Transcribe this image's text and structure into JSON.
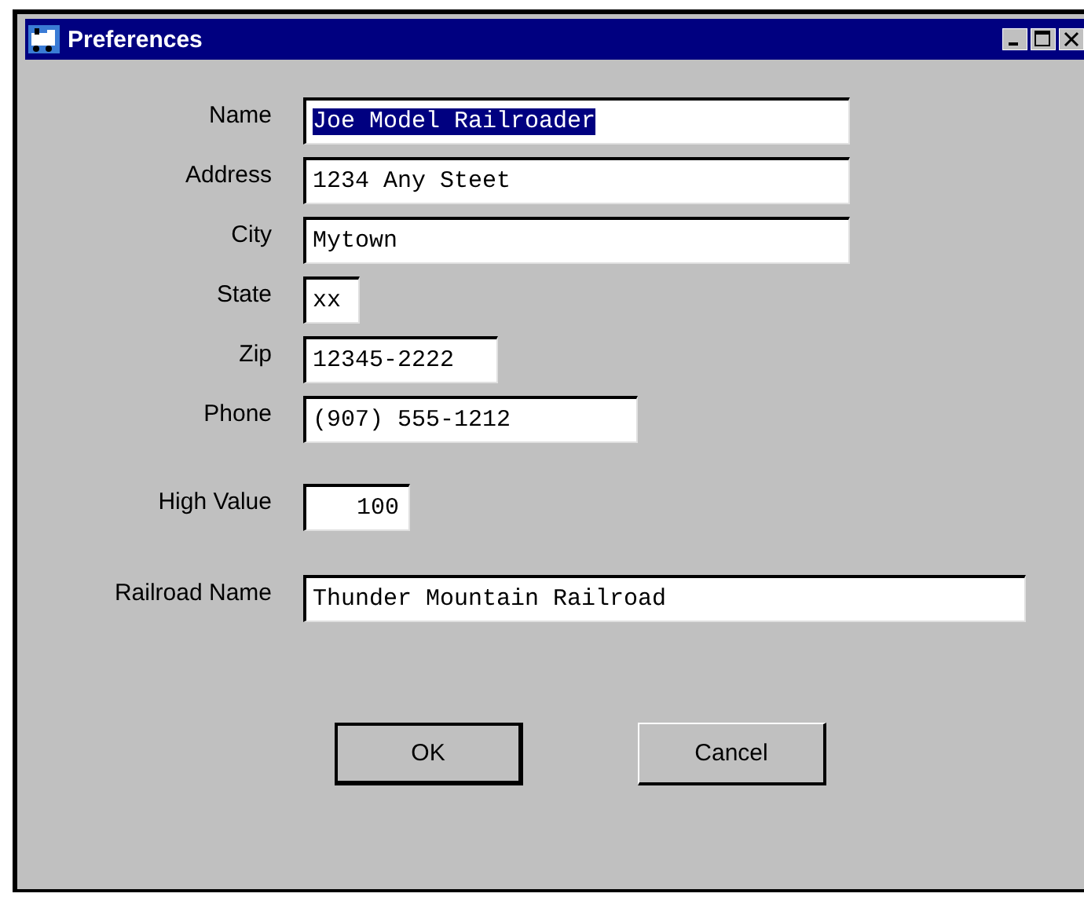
{
  "window": {
    "title": "Preferences"
  },
  "fields": [
    {
      "label": "Name",
      "value": "Joe Model Railroader",
      "text_selected": true,
      "kind": "text"
    },
    {
      "label": "Address",
      "value": "1234 Any Steet",
      "text_selected": false,
      "kind": "text"
    },
    {
      "label": "City",
      "value": "Mytown",
      "text_selected": false,
      "kind": "text"
    },
    {
      "label": "State",
      "value": "xx",
      "text_selected": false,
      "kind": "text"
    },
    {
      "label": "Zip",
      "value": "12345-2222",
      "text_selected": false,
      "kind": "text"
    },
    {
      "label": "Phone",
      "value": "(907) 555-1212",
      "text_selected": false,
      "kind": "text"
    },
    {
      "label": "High Value",
      "value": "100",
      "text_selected": false,
      "kind": "number"
    },
    {
      "label": "Railroad Name",
      "value": "Thunder Mountain Railroad",
      "text_selected": false,
      "kind": "text"
    }
  ],
  "buttons": [
    {
      "label": "OK",
      "default": true
    },
    {
      "label": "Cancel",
      "default": false
    }
  ]
}
